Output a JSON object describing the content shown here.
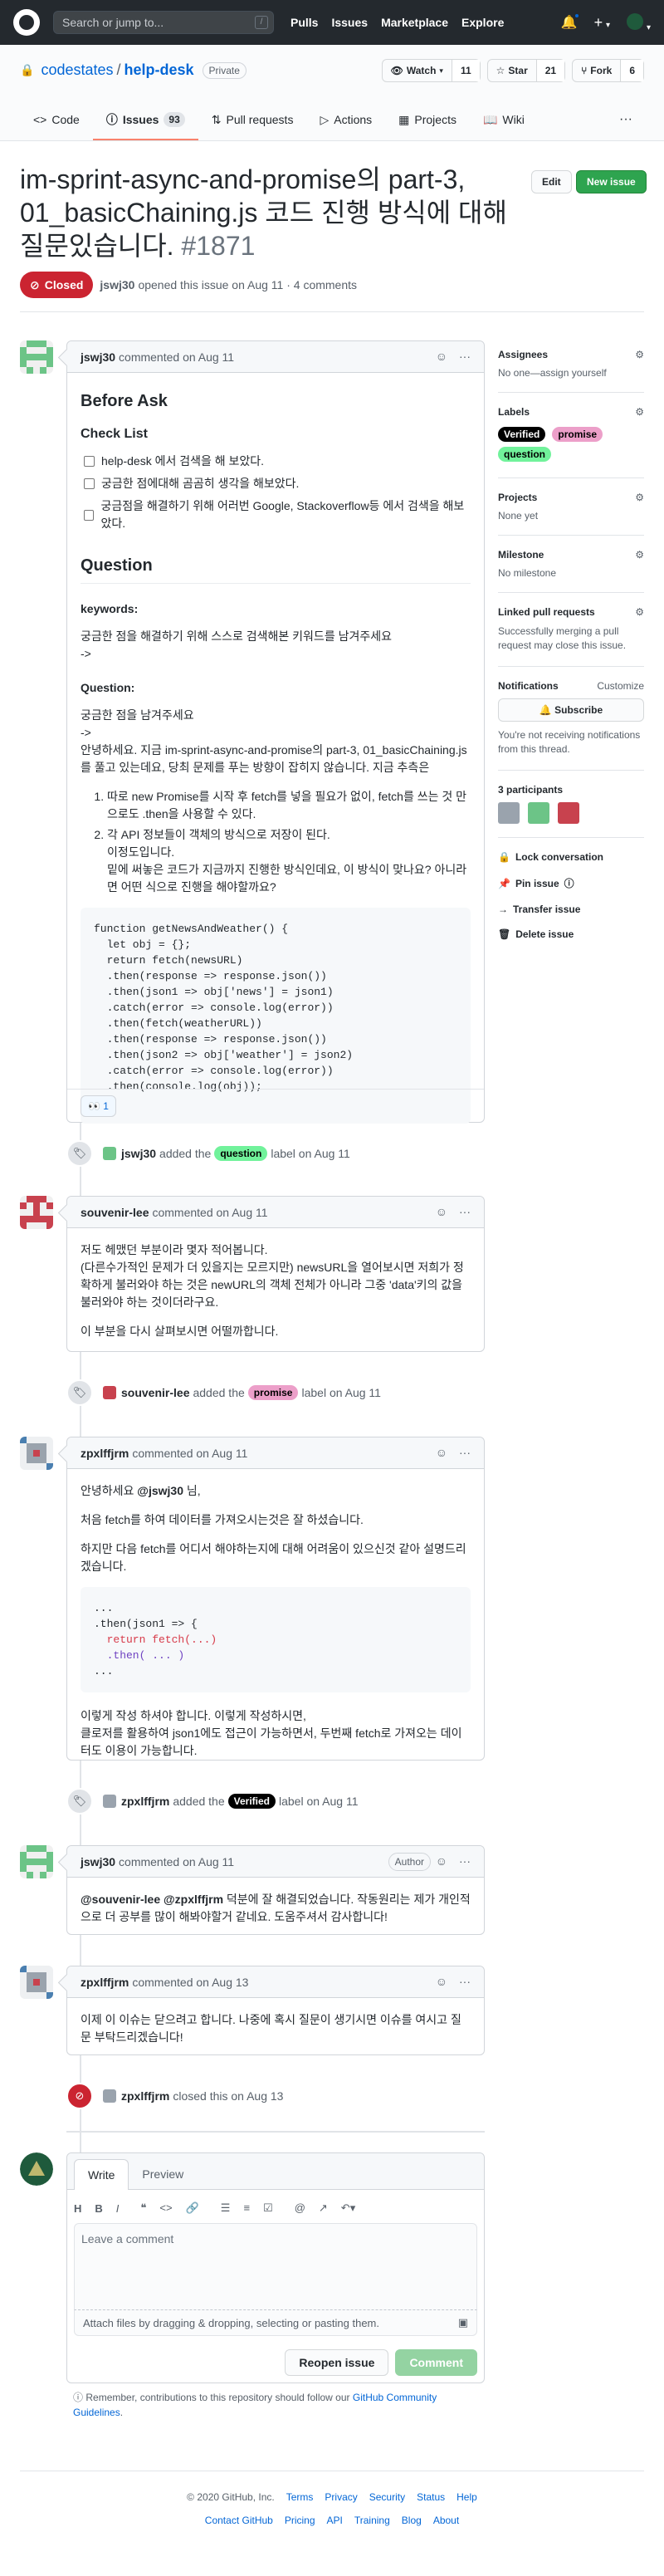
{
  "header": {
    "search_placeholder": "Search or jump to...",
    "slash": "/",
    "nav": [
      "Pulls",
      "Issues",
      "Marketplace",
      "Explore"
    ],
    "plus": "+",
    "caret": "▾"
  },
  "repo": {
    "owner": "codestates",
    "name": "help-desk",
    "visibility": "Private",
    "watch_label": "Watch",
    "watch_count": "11",
    "star_label": "Star",
    "star_count": "21",
    "fork_label": "Fork",
    "fork_count": "6",
    "tabs": [
      {
        "label": "Code"
      },
      {
        "label": "Issues",
        "count": "93"
      },
      {
        "label": "Pull requests"
      },
      {
        "label": "Actions"
      },
      {
        "label": "Projects"
      },
      {
        "label": "Wiki"
      }
    ],
    "more": "···"
  },
  "issue": {
    "title": "im-sprint-async-and-promise의 part-3, 01_basicChaining.js 코드 진행 방식에 대해 질문있습니다.",
    "number": "#1871",
    "edit_label": "Edit",
    "new_label": "New issue",
    "state": "Closed",
    "author": "jswj30",
    "meta": "opened this issue on Aug 11 · 4 comments"
  },
  "comments": [
    {
      "author": "jswj30",
      "meta": "commented on Aug 11",
      "h2": "Before Ask",
      "h3": "Check List",
      "tasks": [
        "help-desk 에서 검색을 해 보았다.",
        "궁금한 점에대해 곰곰히 생각을 해보았다.",
        "궁금점을 해결하기 위해 어러번 Google, Stackoverflow등 에서 검색을 해보았다."
      ],
      "h2b": "Question",
      "kw_title": "keywords:",
      "kw_text": "궁금한 점을 해결하기 위해 스스로 검색해본 키워드를 남겨주세요",
      "arrow": "->",
      "q_title": "Question:",
      "q_text": "궁금한 점을 남겨주세요",
      "q_body": "안녕하세요. 지금 im-sprint-async-and-promise의 part-3, 01_basicChaining.js를 풀고 있는데요, 당최 문제를 푸는 방향이 잡히지 않습니다. 지금 추측은",
      "list": [
        "따로 new Promise를 시작 후 fetch를 넣을 필요가 없이, fetch를 쓰는 것 만으로도 .then을 사용할 수 있다.",
        "각 API 정보들이 객체의 방식으로 저장이 된다."
      ],
      "list_tail_1": "이정도입니다.",
      "list_tail_2": "밑에 써놓은 코드가 지금까지 진행한 방식인데요, 이 방식이 맞나요? 아니라면 어떤 식으로 진행을 해야할까요?",
      "code": [
        "function getNewsAndWeather() {",
        "  let obj = {};",
        "  return fetch(newsURL)",
        "  .then(response => response.json())",
        "  .then(json1 => obj['news'] = json1)",
        "  .catch(error => console.log(error))",
        "  .then(fetch(weatherURL))",
        "  .then(response => response.json())",
        "  .then(json2 => obj['weather'] = json2)",
        "  .catch(error => console.log(error))",
        "  .then(console.log(obj));",
        "}"
      ],
      "reaction_emoji": "👀",
      "reaction_count": "1"
    },
    {
      "author": "souvenir-lee",
      "meta": "commented on Aug 11",
      "p1": "저도 헤맸던 부분이라 몇자 적어봅니다.",
      "p2": "(다른수가적인 문제가 더 있을지는 모르지만) newsURL을 열어보시면 저희가 정확하게 불러와야 하는 것은 newURL의 객체 전체가 아니라 그중 'data'키의 값을 불러와야 하는 것이더라구요.",
      "p3": "이 부분을 다시 살펴보시면 어떨까합니다."
    },
    {
      "author": "zpxlffjrm",
      "meta": "commented on Aug 11",
      "greet_pre": "안녕하세요",
      "greet_mention": "@jswj30",
      "greet_post": "님,",
      "p1": "처음 fetch를 하여 데이터를 가져오시는것은 잘 하셨습니다.",
      "p2": "하지만 다음 fetch를 어디서 해야하는지에 대해 어려움이 있으신것 같아 설명드리겠습니다.",
      "code": [
        "...",
        ".then(json1 => {",
        "  return fetch(...)",
        "  .then( ... )",
        "..."
      ],
      "p3": "이렇게 작성 하셔야 합니다. 이렇게 작성하시면,",
      "p4": "클로저를 활용하여 json1에도 접근이 가능하면서, 두번째 fetch로 가져오는 데이터도 이용이 가능합니다."
    },
    {
      "author": "jswj30",
      "meta": "commented on Aug 11",
      "role": "Author",
      "m1": "@souvenir-lee",
      "m2": "@zpxlffjrm",
      "text": "덕분에 잘 해결되었습니다. 작동원리는 제가 개인적으로 더 공부를 많이 해봐야할거 같네요. 도움주셔서 감사합니다!"
    },
    {
      "author": "zpxlffjrm",
      "meta": "commented on Aug 13",
      "text": "이제 이 이슈는 닫으려고 합니다. 나중에 혹시 질문이 생기시면 이슈를 여시고 질문 부탁드리겠습니다!"
    }
  ],
  "events": [
    {
      "actor": "jswj30",
      "pre": "added the",
      "label": "question",
      "post": "label on Aug 11"
    },
    {
      "actor": "souvenir-lee",
      "pre": "added the",
      "label": "promise",
      "post": "label on Aug 11"
    },
    {
      "actor": "zpxlffjrm",
      "pre": "added the",
      "label": "Verified",
      "post": "label on Aug 11"
    },
    {
      "actor": "zpxlffjrm",
      "text": "closed this on Aug 13"
    }
  ],
  "sidebar": {
    "assignees_title": "Assignees",
    "assignees_value": "No one—assign yourself",
    "labels_title": "Labels",
    "labels": [
      "Verified",
      "promise",
      "question"
    ],
    "projects_title": "Projects",
    "projects_value": "None yet",
    "milestone_title": "Milestone",
    "milestone_value": "No milestone",
    "linked_title": "Linked pull requests",
    "linked_value": "Successfully merging a pull request may close this issue.",
    "notif_title": "Notifications",
    "notif_customize": "Customize",
    "subscribe": "Subscribe",
    "notif_text": "You're not receiving notifications from this thread.",
    "participants": "3 participants",
    "actions": [
      "Lock conversation",
      "Pin issue",
      "Transfer issue",
      "Delete issue"
    ]
  },
  "editor": {
    "tab_write": "Write",
    "tab_preview": "Preview",
    "placeholder": "Leave a comment",
    "attach": "Attach files by dragging & dropping, selecting or pasting them.",
    "reopen": "Reopen issue",
    "comment": "Comment"
  },
  "remember": {
    "text": "Remember, contributions to this repository should follow our",
    "link": "GitHub Community Guidelines",
    "period": "."
  },
  "footer": {
    "row1": [
      "© 2020 GitHub, Inc.",
      "Terms",
      "Privacy",
      "Security",
      "Status",
      "Help"
    ],
    "row2": [
      "Contact GitHub",
      "Pricing",
      "API",
      "Training",
      "Blog",
      "About"
    ]
  },
  "colors": {
    "closed": "#cb2431",
    "primary": "#2ea44f",
    "link": "#0366d6",
    "question": "#71f29b",
    "promise": "#ec9fc9",
    "verified": "#000000"
  }
}
